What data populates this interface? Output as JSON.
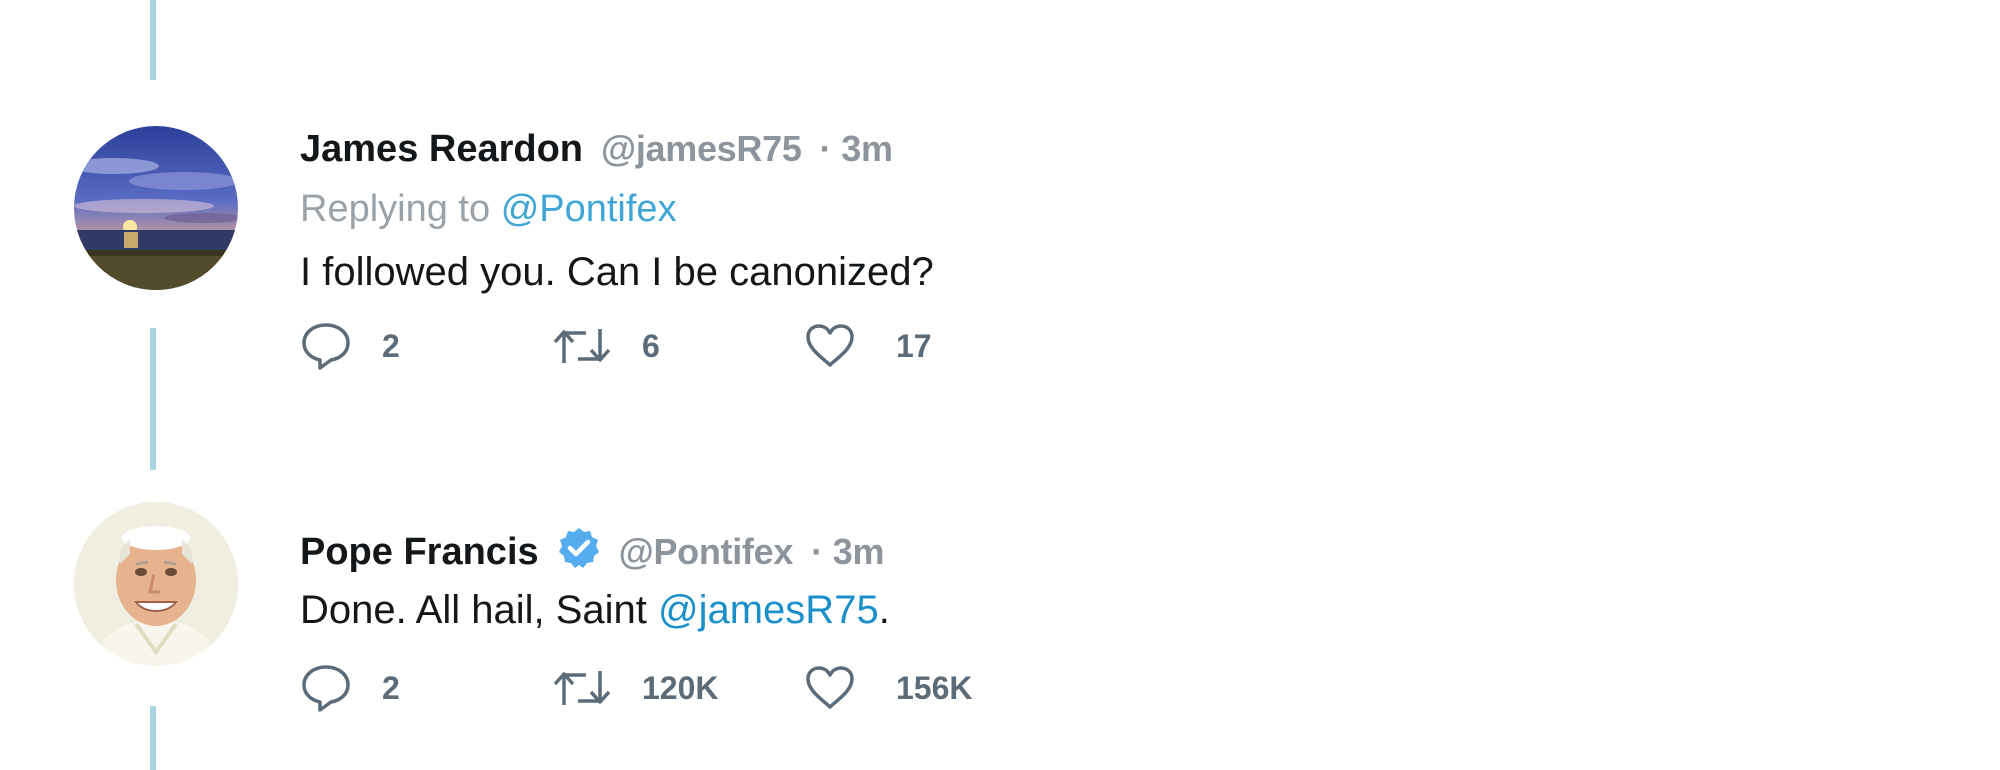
{
  "tweets": [
    {
      "author_name": "James Reardon",
      "handle": "@jamesR75",
      "separator": "·",
      "time": "3m",
      "replying_prefix": "Replying to",
      "replying_to": "@Pontifex",
      "text": "I followed you. Can I be canonized?",
      "replies": "2",
      "retweets": "6",
      "likes": "17",
      "avatar_icon": "sunset-avatar-icon",
      "verified": false
    },
    {
      "author_name": "Pope Francis",
      "handle": "@Pontifex",
      "separator": "·",
      "time": "3m",
      "text_prefix": "Done. All hail, Saint ",
      "text_mention": "@jamesR75",
      "text_suffix": ".",
      "replies": "2",
      "retweets": "120K",
      "likes": "156K",
      "avatar_icon": "pope-avatar-icon",
      "verified": true
    }
  ],
  "colors": {
    "thread_line": "#aad3e2",
    "mention": "#1b8fc9",
    "muted_text": "#8d949b",
    "action_count": "#5b6b78",
    "verified_badge": "#55acee"
  },
  "icons": [
    "reply-icon",
    "retweet-icon",
    "like-icon",
    "verified-badge-icon"
  ]
}
